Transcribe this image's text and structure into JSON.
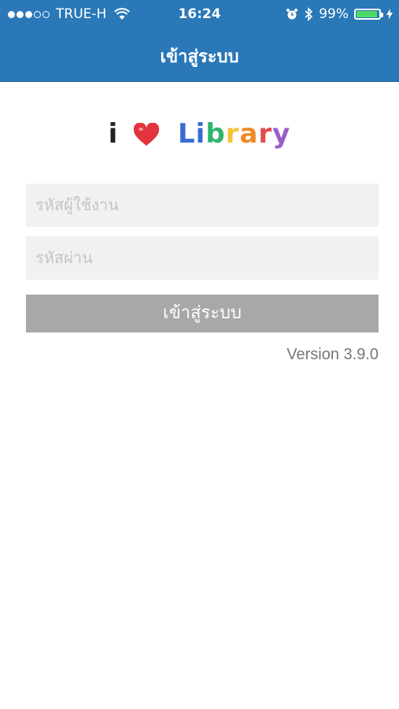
{
  "status_bar": {
    "carrier": "TRUE-H",
    "time": "16:24",
    "battery_percent": "99%",
    "battery_level": 0.99,
    "signal_bars_filled": 3,
    "signal_bars_total": 5
  },
  "nav": {
    "title": "เข้าสู่ระบบ"
  },
  "logo": {
    "letter_i": "i",
    "letters": [
      {
        "ch": "L",
        "color": "#3a6bd1"
      },
      {
        "ch": "i",
        "color": "#3a6bd1"
      },
      {
        "ch": "b",
        "color": "#2eb56c"
      },
      {
        "ch": "r",
        "color": "#f2c43a"
      },
      {
        "ch": "a",
        "color": "#ee8a2a"
      },
      {
        "ch": "r",
        "color": "#e34b4b"
      },
      {
        "ch": "y",
        "color": "#9a5cc9"
      }
    ],
    "heart_color": "#e2343f"
  },
  "form": {
    "username_placeholder": "รหัสผู้ใช้งาน",
    "password_placeholder": "รหัสผ่าน",
    "login_label": "เข้าสู่ระบบ"
  },
  "version": "Version 3.9.0",
  "colors": {
    "nav_bg": "#2a78b8",
    "field_bg": "#f1f1f1",
    "button_bg": "#a8a8a8",
    "battery_fill": "#4cd964"
  }
}
